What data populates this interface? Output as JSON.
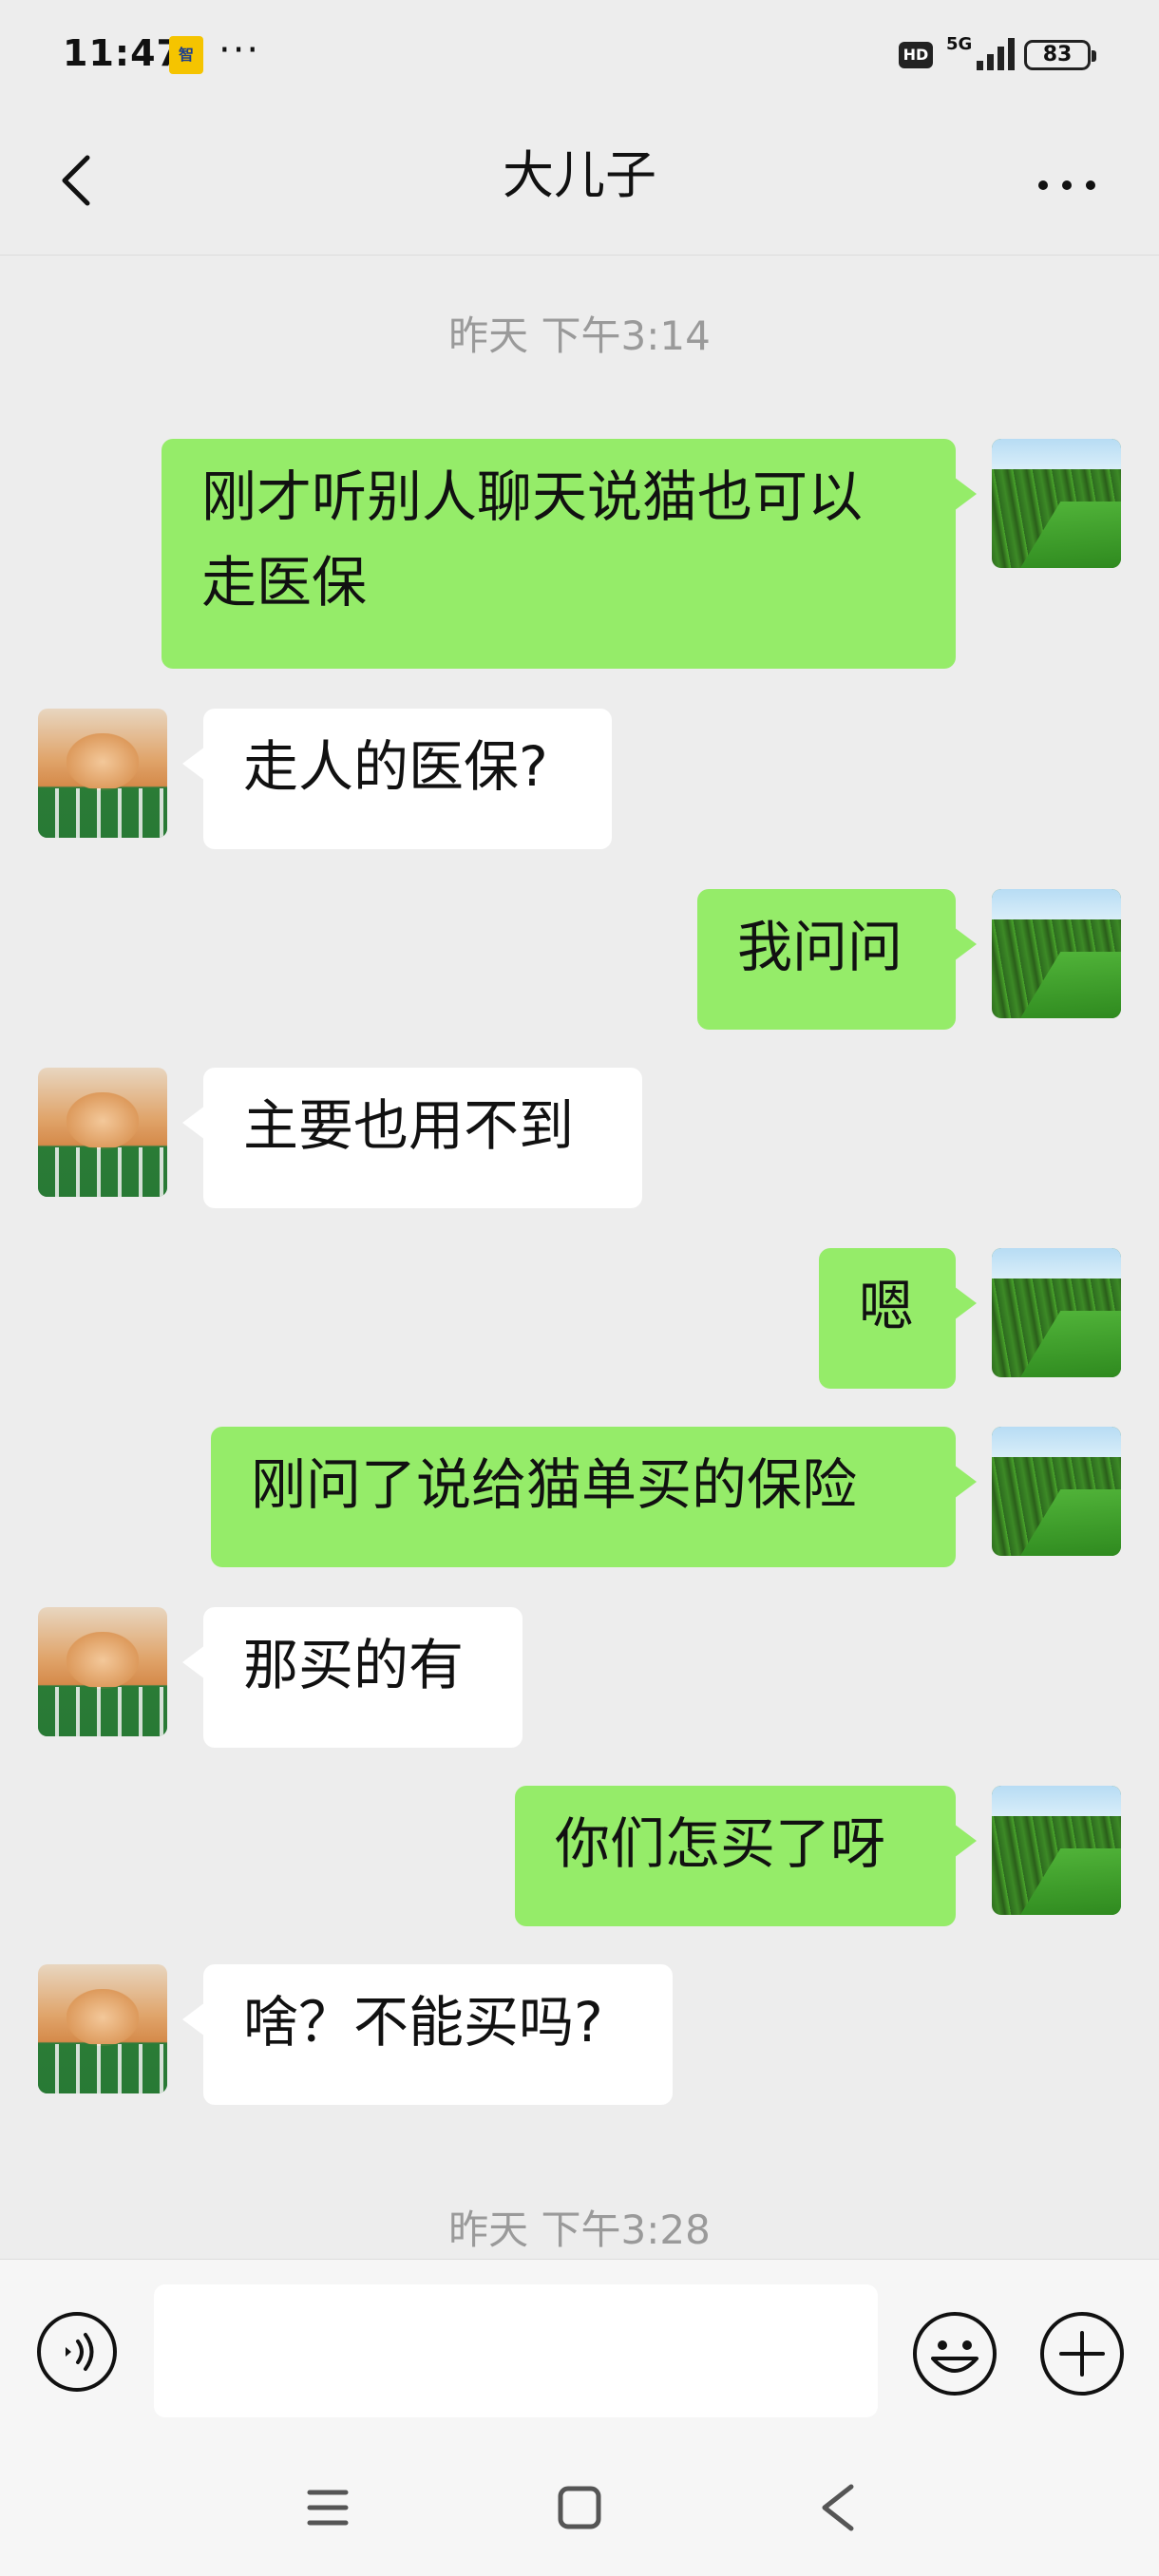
{
  "status_bar": {
    "time": "11:47",
    "app_icon_text": "智",
    "more_dots": "···",
    "hd": "HD",
    "network": "5G",
    "battery": "83"
  },
  "nav": {
    "title": "大儿子"
  },
  "chat": {
    "timestamps": [
      "昨天 下午3:14",
      "昨天 下午3:28"
    ],
    "messages": [
      {
        "side": "out",
        "text": "刚才听别人聊天说猫也可以\n走医保"
      },
      {
        "side": "in",
        "text": "走人的医保?"
      },
      {
        "side": "out",
        "text": "我问问"
      },
      {
        "side": "in",
        "text": "主要也用不到"
      },
      {
        "side": "out",
        "text": "嗯"
      },
      {
        "side": "out",
        "text": "刚问了说给猫单买的保险"
      },
      {
        "side": "in",
        "text": "那买的有"
      },
      {
        "side": "out",
        "text": "你们怎买了呀"
      },
      {
        "side": "in",
        "text": "啥？不能买吗?"
      }
    ]
  },
  "input": {
    "value": "",
    "placeholder": ""
  },
  "colors": {
    "background": "#ededed",
    "outgoing_bubble": "#95ec69",
    "incoming_bubble": "#ffffff",
    "timestamp": "#9a9a9a"
  },
  "icons": {
    "back": "chevron-left-icon",
    "more": "more-dots-icon",
    "voice": "voice-icon",
    "emoji": "emoji-icon",
    "plus": "plus-icon",
    "menu": "menu-icon",
    "home": "home-square-icon",
    "system_back": "back-icon"
  }
}
